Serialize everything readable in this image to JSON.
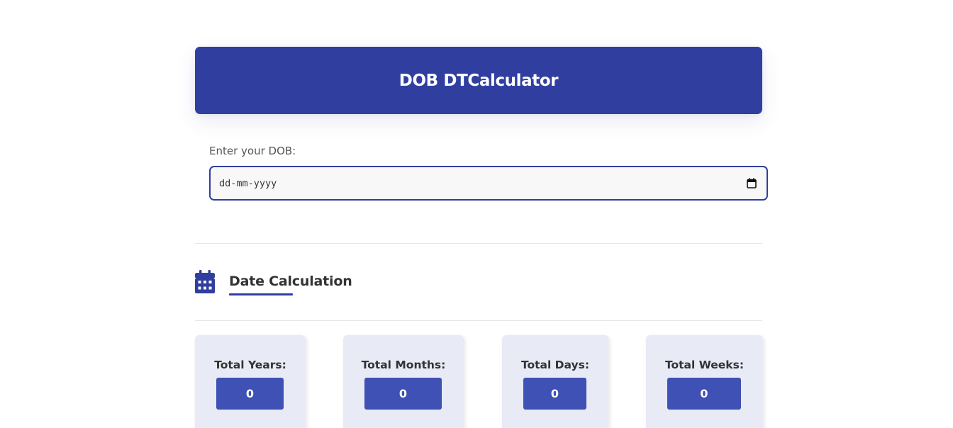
{
  "header": {
    "title": "DOB DTCalculator"
  },
  "dob": {
    "label": "Enter your DOB:",
    "placeholder": "dd-mm-yyyy",
    "value": "",
    "picker_icon": "calendar-icon"
  },
  "section": {
    "icon": "calendar-icon",
    "title": "Date Calculation"
  },
  "stats": [
    {
      "label": "Total Years:",
      "value": "0"
    },
    {
      "label": "Total Months:",
      "value": "0"
    },
    {
      "label": "Total Days:",
      "value": "0"
    },
    {
      "label": "Total Weeks:",
      "value": "0"
    }
  ],
  "colors": {
    "primary": "#303f9f",
    "value_box": "#3f51b5",
    "card_background": "#e8eaf6",
    "text": "#333333"
  }
}
